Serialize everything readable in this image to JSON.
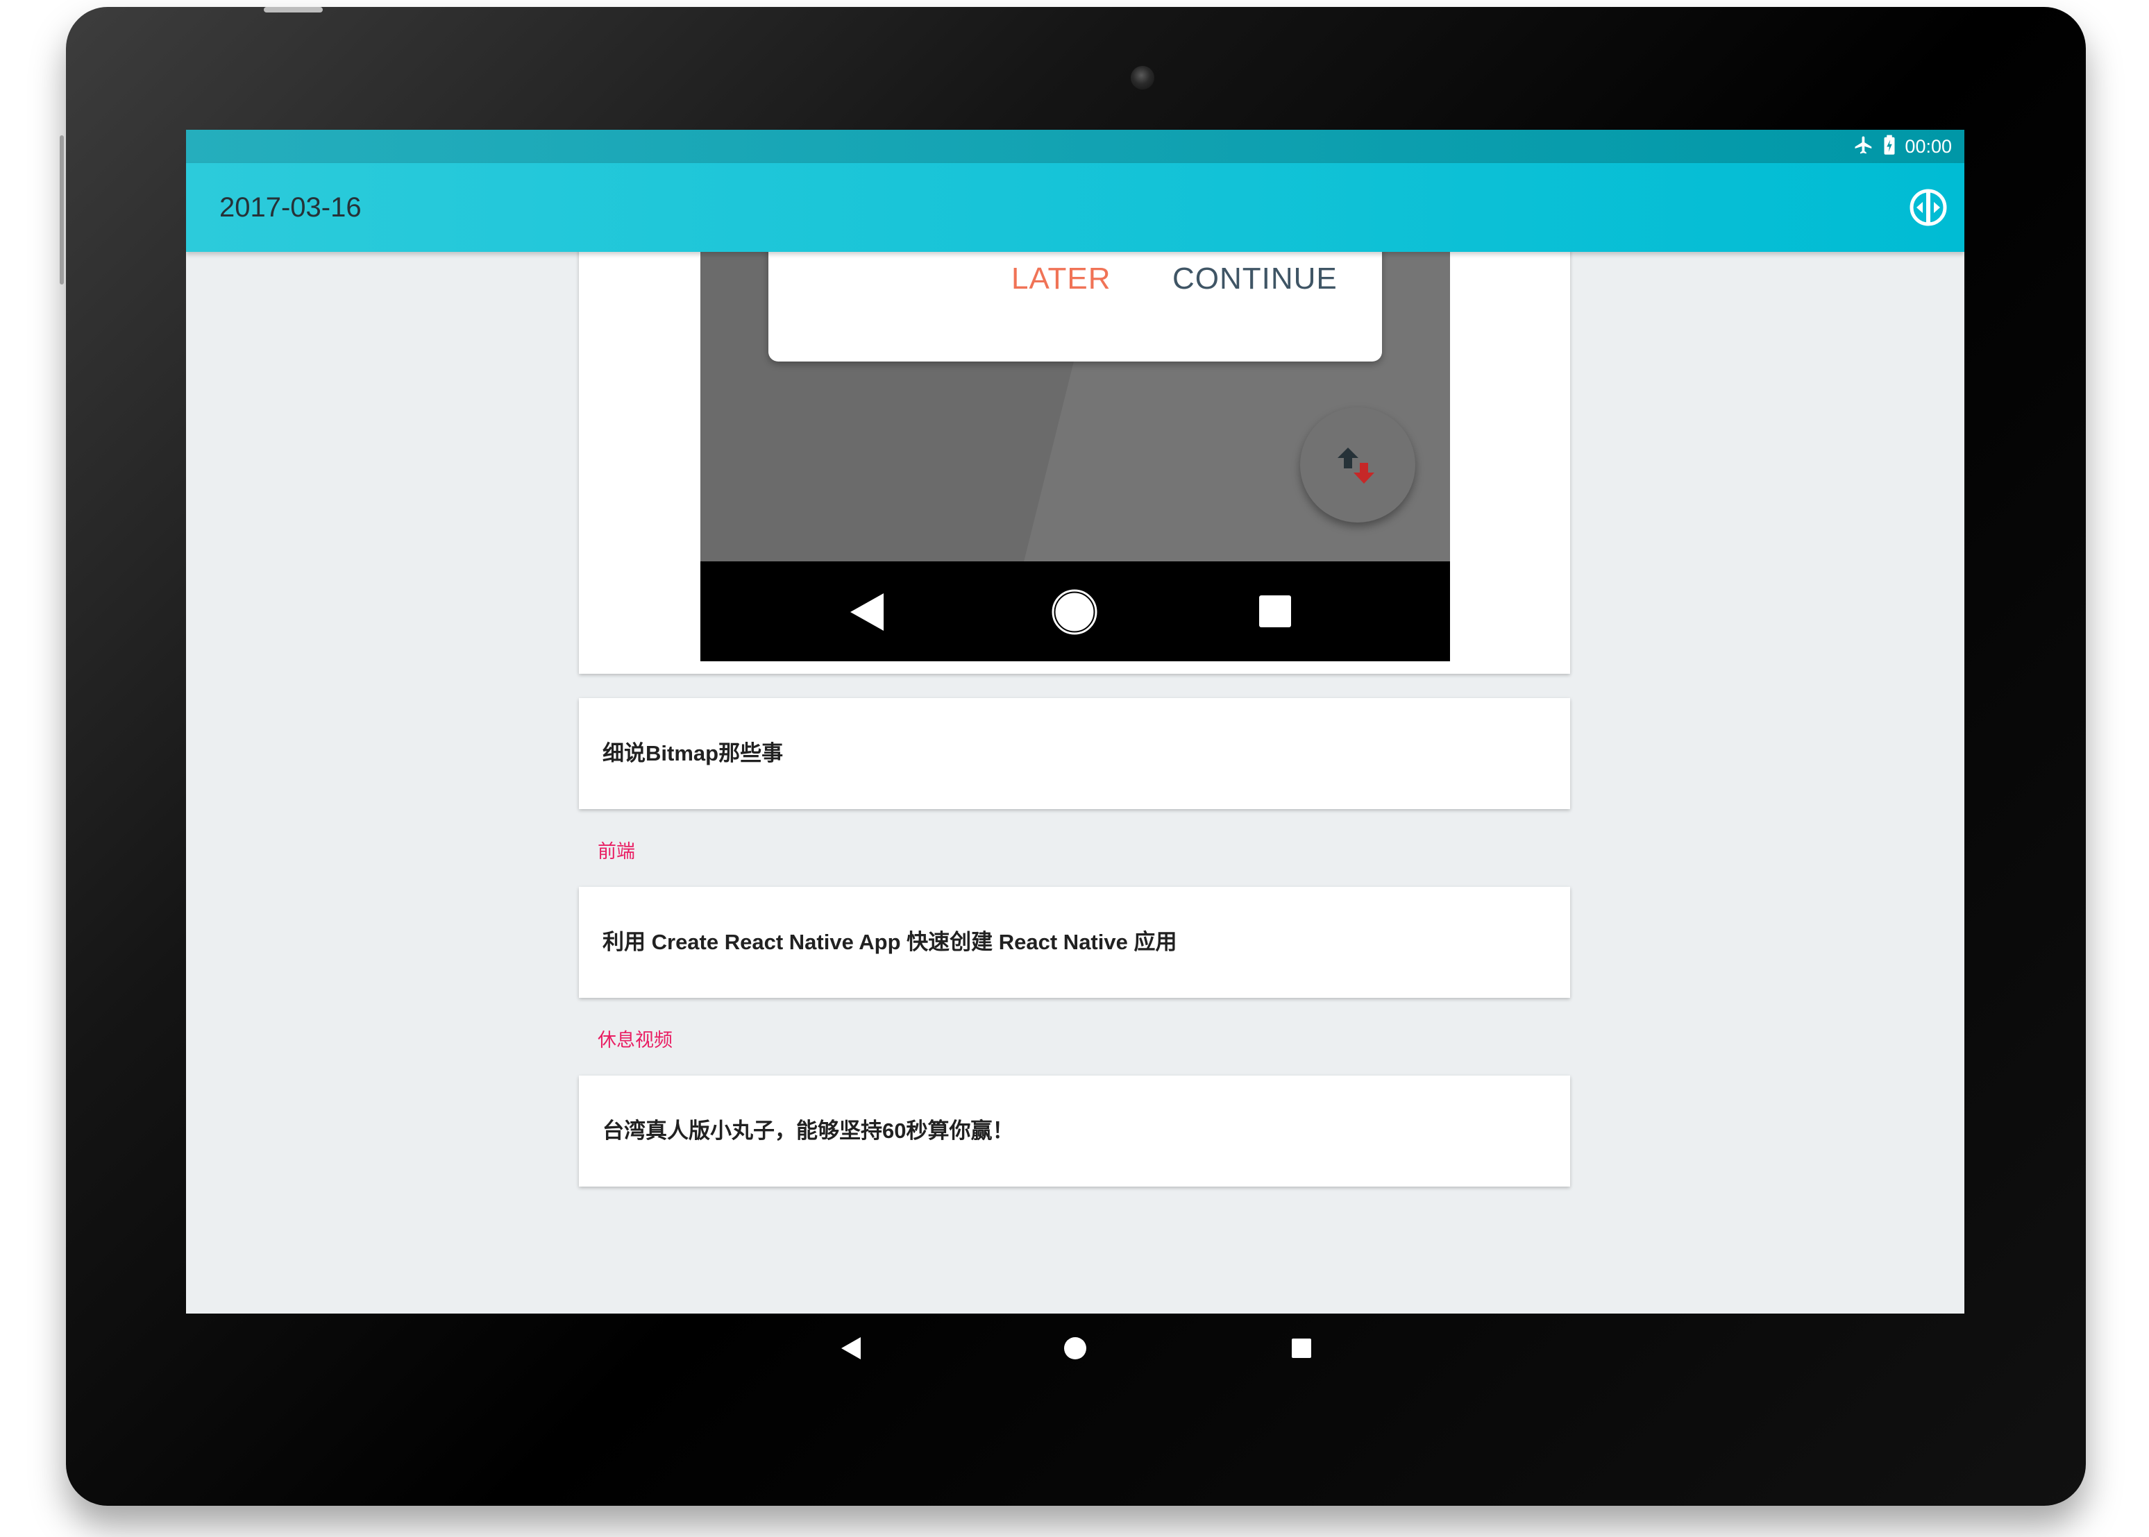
{
  "status_bar": {
    "time": "00:00",
    "icons": [
      "airplane-mode-icon",
      "battery-charging-icon"
    ]
  },
  "app_bar": {
    "title": "2017-03-16",
    "action_icon": "theme-switch-icon"
  },
  "image_card": {
    "dialog": {
      "later_label": "LATER",
      "continue_label": "CONTINUE"
    },
    "fab_icon": "transfer-arrows-icon",
    "nav_icons": [
      "back-icon",
      "home-icon",
      "recents-icon"
    ]
  },
  "articles": [
    {
      "title": "细说Bitmap那些事"
    },
    {
      "title": "利用 Create React Native App 快速创建 React Native 应用"
    },
    {
      "title": "台湾真人版小丸子，能够坚持60秒算你赢！"
    }
  ],
  "sections": [
    {
      "label": "前端"
    },
    {
      "label": "休息视频"
    }
  ],
  "colors": {
    "accent": "#00bcd4",
    "section_label": "#e91e63",
    "later": "#f07356",
    "continue": "#3f5565"
  },
  "system_nav": [
    "back-icon",
    "home-icon",
    "recents-icon"
  ]
}
